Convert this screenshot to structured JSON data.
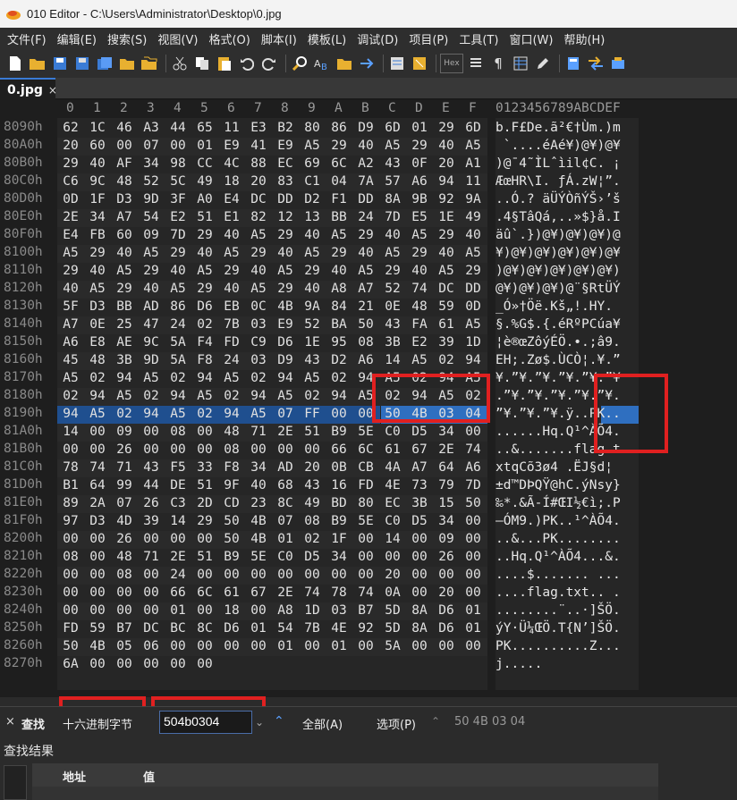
{
  "window": {
    "title": "010 Editor - C:\\Users\\Administrator\\Desktop\\0.jpg"
  },
  "menu": [
    "文件(F)",
    "编辑(E)",
    "搜索(S)",
    "视图(V)",
    "格式(O)",
    "脚本(I)",
    "模板(L)",
    "调试(D)",
    "项目(P)",
    "工具(T)",
    "窗口(W)",
    "帮助(H)"
  ],
  "toolbar": {
    "hex_label": "Hex"
  },
  "tab": {
    "label": "0.jpg",
    "close": "×"
  },
  "hex": {
    "header_cols": [
      "0",
      "1",
      "2",
      "3",
      "4",
      "5",
      "6",
      "7",
      "8",
      "9",
      "A",
      "B",
      "C",
      "D",
      "E",
      "F"
    ],
    "ascii_header": "0123456789ABCDEF",
    "rows": [
      {
        "addr": "8090h",
        "bytes": [
          "62",
          "1C",
          "46",
          "A3",
          "44",
          "65",
          "11",
          "E3",
          "B2",
          "80",
          "86",
          "D9",
          "6D",
          "01",
          "29",
          "6D"
        ],
        "ascii": "b.F£De.ã²€†Ùm.)m"
      },
      {
        "addr": "80A0h",
        "bytes": [
          "20",
          "60",
          "00",
          "07",
          "00",
          "01",
          "E9",
          "41",
          "E9",
          "A5",
          "29",
          "40",
          "A5",
          "29",
          "40",
          "A5"
        ],
        "ascii": " `....éAé¥)@¥)@¥"
      },
      {
        "addr": "80B0h",
        "bytes": [
          "29",
          "40",
          "AF",
          "34",
          "98",
          "CC",
          "4C",
          "88",
          "EC",
          "69",
          "6C",
          "A2",
          "43",
          "0F",
          "20",
          "A1"
        ],
        "ascii": ")@¯4˜ÌLˆìil¢C. ¡"
      },
      {
        "addr": "80C0h",
        "bytes": [
          "C6",
          "9C",
          "48",
          "52",
          "5C",
          "49",
          "18",
          "20",
          "83",
          "C1",
          "04",
          "7A",
          "57",
          "A6",
          "94",
          "11"
        ],
        "ascii": "ÆœHR\\I. ƒÁ.zW¦”."
      },
      {
        "addr": "80D0h",
        "bytes": [
          "0D",
          "1F",
          "D3",
          "9D",
          "3F",
          "A0",
          "E4",
          "DC",
          "DD",
          "D2",
          "F1",
          "DD",
          "8A",
          "9B",
          "92",
          "9A"
        ],
        "ascii": "..Ó.? äÜÝÒñÝŠ›’š"
      },
      {
        "addr": "80E0h",
        "bytes": [
          "2E",
          "34",
          "A7",
          "54",
          "E2",
          "51",
          "E1",
          "82",
          "12",
          "13",
          "BB",
          "24",
          "7D",
          "E5",
          "1E",
          "49"
        ],
        "ascii": ".4§TâQá‚..»$}å.I"
      },
      {
        "addr": "80F0h",
        "bytes": [
          "E4",
          "FB",
          "60",
          "09",
          "7D",
          "29",
          "40",
          "A5",
          "29",
          "40",
          "A5",
          "29",
          "40",
          "A5",
          "29",
          "40"
        ],
        "ascii": "äû`.})@¥)@¥)@¥)@"
      },
      {
        "addr": "8100h",
        "bytes": [
          "A5",
          "29",
          "40",
          "A5",
          "29",
          "40",
          "A5",
          "29",
          "40",
          "A5",
          "29",
          "40",
          "A5",
          "29",
          "40",
          "A5"
        ],
        "ascii": "¥)@¥)@¥)@¥)@¥)@¥"
      },
      {
        "addr": "8110h",
        "bytes": [
          "29",
          "40",
          "A5",
          "29",
          "40",
          "A5",
          "29",
          "40",
          "A5",
          "29",
          "40",
          "A5",
          "29",
          "40",
          "A5",
          "29"
        ],
        "ascii": ")@¥)@¥)@¥)@¥)@¥)"
      },
      {
        "addr": "8120h",
        "bytes": [
          "40",
          "A5",
          "29",
          "40",
          "A5",
          "29",
          "40",
          "A5",
          "29",
          "40",
          "A8",
          "A7",
          "52",
          "74",
          "DC",
          "DD"
        ],
        "ascii": "@¥)@¥)@¥)@¨§RtÜÝ"
      },
      {
        "addr": "8130h",
        "bytes": [
          "5F",
          "D3",
          "BB",
          "AD",
          "86",
          "D6",
          "EB",
          "0C",
          "4B",
          "9A",
          "84",
          "21",
          "0E",
          "48",
          "59",
          "0D"
        ],
        "ascii": "_Ó»­†Öë.Kš„!.HY."
      },
      {
        "addr": "8140h",
        "bytes": [
          "A7",
          "0E",
          "25",
          "47",
          "24",
          "02",
          "7B",
          "03",
          "E9",
          "52",
          "BA",
          "50",
          "43",
          "FA",
          "61",
          "A5"
        ],
        "ascii": "§.%G$.{.éRºPCúa¥"
      },
      {
        "addr": "8150h",
        "bytes": [
          "A6",
          "E8",
          "AE",
          "9C",
          "5A",
          "F4",
          "FD",
          "C9",
          "D6",
          "1E",
          "95",
          "08",
          "3B",
          "E2",
          "39",
          "1D"
        ],
        "ascii": "¦è®œZôýÉÖ.•.;â9."
      },
      {
        "addr": "8160h",
        "bytes": [
          "45",
          "48",
          "3B",
          "9D",
          "5A",
          "F8",
          "24",
          "03",
          "D9",
          "43",
          "D2",
          "A6",
          "14",
          "A5",
          "02",
          "94"
        ],
        "ascii": "EH;.Zø$.ÙCÒ¦.¥.”"
      },
      {
        "addr": "8170h",
        "bytes": [
          "A5",
          "02",
          "94",
          "A5",
          "02",
          "94",
          "A5",
          "02",
          "94",
          "A5",
          "02",
          "94",
          "A5",
          "02",
          "94",
          "A5"
        ],
        "ascii": "¥.”¥.”¥.”¥.”¥.”¥"
      },
      {
        "addr": "8180h",
        "bytes": [
          "02",
          "94",
          "A5",
          "02",
          "94",
          "A5",
          "02",
          "94",
          "A5",
          "02",
          "94",
          "A5",
          "02",
          "94",
          "A5",
          "02"
        ],
        "ascii": ".”¥.”¥.”¥.”¥.”¥."
      },
      {
        "addr": "8190h",
        "bytes": [
          "94",
          "A5",
          "02",
          "94",
          "A5",
          "02",
          "94",
          "A5",
          "07",
          "FF",
          "00",
          "00",
          "50",
          "4B",
          "03",
          "04"
        ],
        "ascii": "”¥.”¥.”¥.ÿ..PK.."
      },
      {
        "addr": "81A0h",
        "bytes": [
          "14",
          "00",
          "09",
          "00",
          "08",
          "00",
          "48",
          "71",
          "2E",
          "51",
          "B9",
          "5E",
          "C0",
          "D5",
          "34",
          "00"
        ],
        "ascii": "......Hq.Q¹^ÀÕ4."
      },
      {
        "addr": "81B0h",
        "bytes": [
          "00",
          "00",
          "26",
          "00",
          "00",
          "00",
          "08",
          "00",
          "00",
          "00",
          "66",
          "6C",
          "61",
          "67",
          "2E",
          "74"
        ],
        "ascii": "..&.......flag.t"
      },
      {
        "addr": "81C0h",
        "bytes": [
          "78",
          "74",
          "71",
          "43",
          "F5",
          "33",
          "F8",
          "34",
          "AD",
          "20",
          "0B",
          "CB",
          "4A",
          "A7",
          "64",
          "A6"
        ],
        "ascii": "xtqCõ3ø4­ .ËJ§d¦"
      },
      {
        "addr": "81D0h",
        "bytes": [
          "B1",
          "64",
          "99",
          "44",
          "DE",
          "51",
          "9F",
          "40",
          "68",
          "43",
          "16",
          "FD",
          "4E",
          "73",
          "79",
          "7D"
        ],
        "ascii": "±d™DÞQŸ@hC.ýNsy}"
      },
      {
        "addr": "81E0h",
        "bytes": [
          "89",
          "2A",
          "07",
          "26",
          "C3",
          "2D",
          "CD",
          "23",
          "8C",
          "49",
          "BD",
          "80",
          "EC",
          "3B",
          "15",
          "50"
        ],
        "ascii": "‰*.&Ã-Í#ŒI½€ì;.P"
      },
      {
        "addr": "81F0h",
        "bytes": [
          "97",
          "D3",
          "4D",
          "39",
          "14",
          "29",
          "50",
          "4B",
          "07",
          "08",
          "B9",
          "5E",
          "C0",
          "D5",
          "34",
          "00"
        ],
        "ascii": "—ÓM9.)PK..¹^ÀÕ4."
      },
      {
        "addr": "8200h",
        "bytes": [
          "00",
          "00",
          "26",
          "00",
          "00",
          "00",
          "50",
          "4B",
          "01",
          "02",
          "1F",
          "00",
          "14",
          "00",
          "09",
          "00"
        ],
        "ascii": "..&...PK........"
      },
      {
        "addr": "8210h",
        "bytes": [
          "08",
          "00",
          "48",
          "71",
          "2E",
          "51",
          "B9",
          "5E",
          "C0",
          "D5",
          "34",
          "00",
          "00",
          "00",
          "26",
          "00"
        ],
        "ascii": "..Hq.Q¹^ÀÕ4...&."
      },
      {
        "addr": "8220h",
        "bytes": [
          "00",
          "00",
          "08",
          "00",
          "24",
          "00",
          "00",
          "00",
          "00",
          "00",
          "00",
          "00",
          "20",
          "00",
          "00",
          "00"
        ],
        "ascii": "....$....... ..."
      },
      {
        "addr": "8230h",
        "bytes": [
          "00",
          "00",
          "00",
          "00",
          "66",
          "6C",
          "61",
          "67",
          "2E",
          "74",
          "78",
          "74",
          "0A",
          "00",
          "20",
          "00"
        ],
        "ascii": "....flag.txt.. ."
      },
      {
        "addr": "8240h",
        "bytes": [
          "00",
          "00",
          "00",
          "00",
          "01",
          "00",
          "18",
          "00",
          "A8",
          "1D",
          "03",
          "B7",
          "5D",
          "8A",
          "D6",
          "01"
        ],
        "ascii": "........¨..·]ŠÖ."
      },
      {
        "addr": "8250h",
        "bytes": [
          "FD",
          "59",
          "B7",
          "DC",
          "BC",
          "8C",
          "D6",
          "01",
          "54",
          "7B",
          "4E",
          "92",
          "5D",
          "8A",
          "D6",
          "01"
        ],
        "ascii": "ýY·Ü¼ŒÖ.T{N’]ŠÖ."
      },
      {
        "addr": "8260h",
        "bytes": [
          "50",
          "4B",
          "05",
          "06",
          "00",
          "00",
          "00",
          "00",
          "01",
          "00",
          "01",
          "00",
          "5A",
          "00",
          "00",
          "00"
        ],
        "ascii": "PK..........Z..."
      },
      {
        "addr": "8270h",
        "bytes": [
          "6A",
          "00",
          "00",
          "00",
          "00",
          "00"
        ],
        "ascii": "j....."
      }
    ]
  },
  "find": {
    "close": "×",
    "label": "查找",
    "type": "十六进制字节",
    "value": "504b0304",
    "all": "全部(A)",
    "options": "选项(P)",
    "history": "50 4B 03 04"
  },
  "results": {
    "title": "查找结果",
    "col_addr": "地址",
    "col_value": "值"
  },
  "colors": {
    "selection": "#1f4f8f",
    "highlight_box": "#e02020",
    "accent": "#3a7bd5"
  }
}
